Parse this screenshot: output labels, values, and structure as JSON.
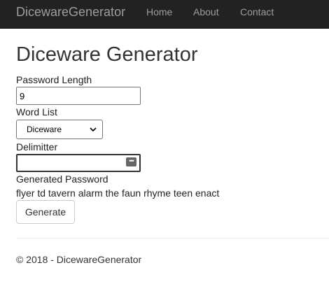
{
  "navbar": {
    "brand": "DicewareGenerator",
    "links": [
      "Home",
      "About",
      "Contact"
    ],
    "background": "#222222",
    "link_color": "#9d9d9d"
  },
  "main": {
    "title": "Diceware Generator",
    "password_length": {
      "label": "Password Length",
      "value": "9"
    },
    "word_list": {
      "label": "Word List",
      "selected": "Diceware"
    },
    "delimiter": {
      "label": "Delimitter",
      "value": "",
      "icon": "password-manager-icon"
    },
    "generated": {
      "label": "Generated Password",
      "value": "flyer td tavern alarm the faun rhyme teen enact"
    },
    "generate_button": "Generate"
  },
  "footer": {
    "text": "© 2018 - DicewareGenerator"
  }
}
